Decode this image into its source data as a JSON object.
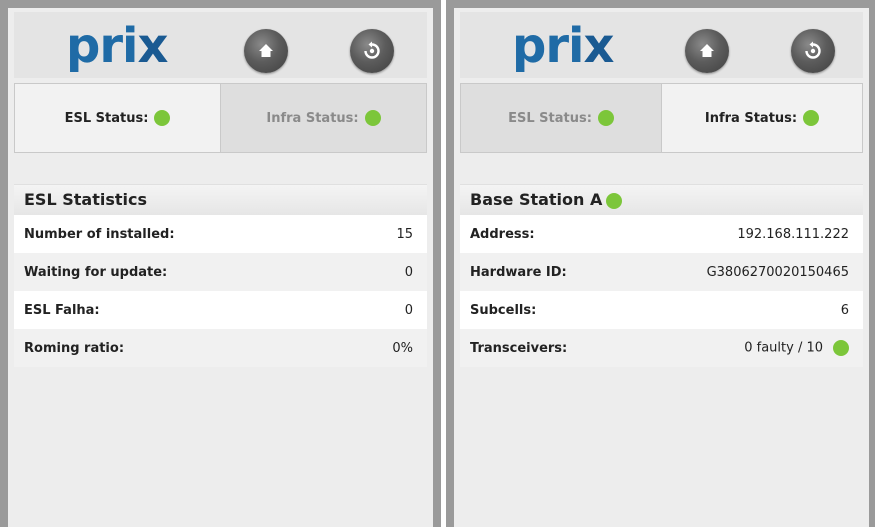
{
  "brand": {
    "logo_main": "pri",
    "logo_x": "x"
  },
  "left_panel": {
    "tabs": [
      {
        "label": "ESL Status:",
        "state": "active"
      },
      {
        "label": "Infra Status:",
        "state": "inactive"
      }
    ],
    "section_title": "ESL Statistics",
    "rows": [
      {
        "label": "Number of installed:",
        "value": "15"
      },
      {
        "label": "Waiting for update:",
        "value": "0"
      },
      {
        "label": "ESL Falha:",
        "value": "0"
      },
      {
        "label": "Roming ratio:",
        "value": "0%"
      }
    ]
  },
  "right_panel": {
    "tabs": [
      {
        "label": "ESL Status:",
        "state": "inactive"
      },
      {
        "label": "Infra Status:",
        "state": "active"
      }
    ],
    "section_title": "Base Station A",
    "rows": [
      {
        "label": "Address:",
        "value": "192.168.111.222"
      },
      {
        "label": "Hardware ID:",
        "value": "G3806270020150465"
      },
      {
        "label": "Subcells:",
        "value": "6"
      },
      {
        "label": "Transceivers:",
        "value": "0 faulty / 10"
      }
    ]
  },
  "colors": {
    "status_ok": "#7cc63a",
    "logo_blue": "#1f6ba6",
    "frame": "#9a9a9a"
  },
  "icons": {
    "home": "home-icon",
    "refresh": "refresh-icon",
    "status": "status-dot-icon"
  }
}
